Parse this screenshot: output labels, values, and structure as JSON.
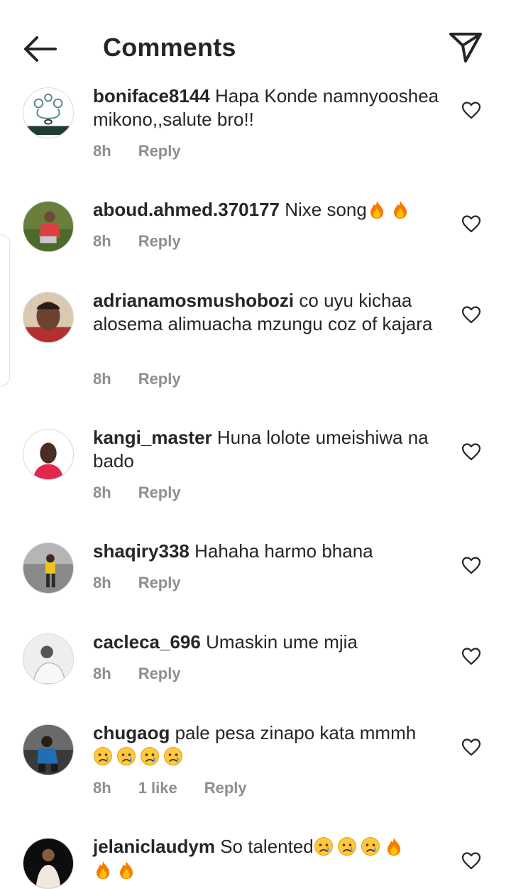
{
  "header": {
    "title": "Comments",
    "back_icon": "arrow-left-icon",
    "send_icon": "paper-plane-icon"
  },
  "colors": {
    "text": "#262626",
    "meta": "#8e8e8e",
    "icon": "#262626"
  },
  "comments": [
    {
      "username": "boniface8144",
      "text": "Hapa Konde namnyooshea mikono,,salute bro!!",
      "time": "8h",
      "reply": "Reply"
    },
    {
      "username": "aboud.ahmed.370177",
      "text": "Nixe song",
      "emojis": [
        "fire",
        "fire"
      ],
      "time": "8h",
      "reply": "Reply"
    },
    {
      "username": "adrianamosmushobozi",
      "text": "co uyu kichaa alosema alimuacha mzungu coz of kajara",
      "time": "8h",
      "reply": "Reply"
    },
    {
      "username": "kangi_master",
      "text": "Huna lolote umeishiwa na bado",
      "time": "8h",
      "reply": "Reply"
    },
    {
      "username": "shaqiry338",
      "text": "Hahaha harmo bhana",
      "time": "8h",
      "reply": "Reply"
    },
    {
      "username": "cacleca_696",
      "text": "Umaskin ume mjia",
      "time": "8h",
      "reply": "Reply"
    },
    {
      "username": "chugaog",
      "text": "pale pesa zinapo kata mmmh",
      "emojis": [
        "sad-tear",
        "sad-tear",
        "sad-tear",
        "sad-tear"
      ],
      "time": "8h",
      "likes": "1 like",
      "reply": "Reply"
    },
    {
      "username": "jelaniclaudym",
      "text": "So talented",
      "emojis": [
        "sad-tear",
        "sad-tear",
        "sad-tear",
        "fire",
        "fire",
        "fire"
      ],
      "time": "8h",
      "reply": "Reply"
    }
  ]
}
